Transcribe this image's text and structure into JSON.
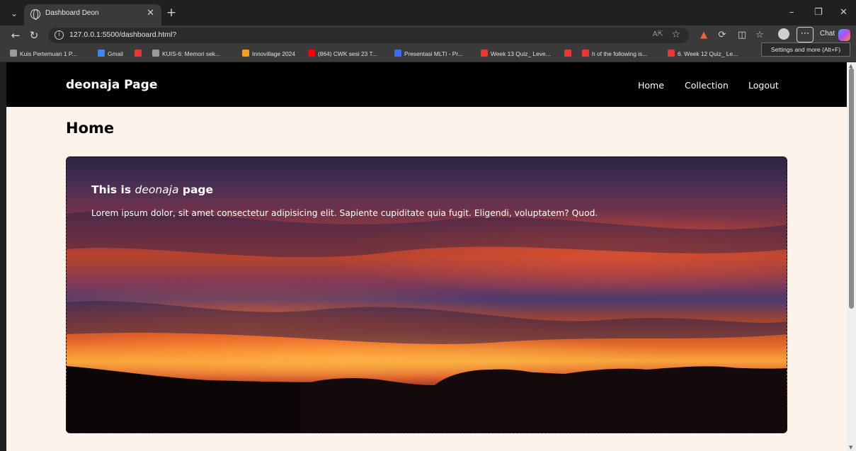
{
  "browser": {
    "tab_title": "Dashboard Deon",
    "url": "127.0.0.1:5500/dashboard.html?",
    "chat_label": "Chat",
    "tooltip": "Settings and more (Alt+F)",
    "bookmarks": [
      {
        "label": "Kuis Pertemuan 1 P...",
        "icon_color": "#9a9a9a"
      },
      {
        "label": "Gmail",
        "icon_color": "#4285f4"
      },
      {
        "label": "",
        "icon_color": "#e53935"
      },
      {
        "label": "KUIS-6: Memori sek...",
        "icon_color": "#9a9a9a"
      },
      {
        "label": "Innovillage 2024",
        "icon_color": "#f0a020"
      },
      {
        "label": "(864) CWK sesi 23 T...",
        "icon_color": "#ff0000"
      },
      {
        "label": "Presentasi MLTI - Pr...",
        "icon_color": "#3d6df2"
      },
      {
        "label": "Week 13 Quiz_ Leve...",
        "icon_color": "#e53935"
      },
      {
        "label": "",
        "icon_color": "#e53935"
      },
      {
        "label": "h of the following is...",
        "icon_color": "#e53935"
      },
      {
        "label": "6. Week 12 Quiz_ Le...",
        "icon_color": "#e53935"
      }
    ]
  },
  "site": {
    "brand": "deonaja Page",
    "nav": [
      "Home",
      "Collection",
      "Logout"
    ],
    "page_title": "Home",
    "hero": {
      "title_prefix": "This is ",
      "title_emphasis": "deonaja",
      "title_suffix": " page",
      "text": "Lorem ipsum dolor, sit amet consectetur adipisicing elit. Sapiente cupiditate quia fugit. Eligendi, voluptatem? Quod."
    }
  }
}
